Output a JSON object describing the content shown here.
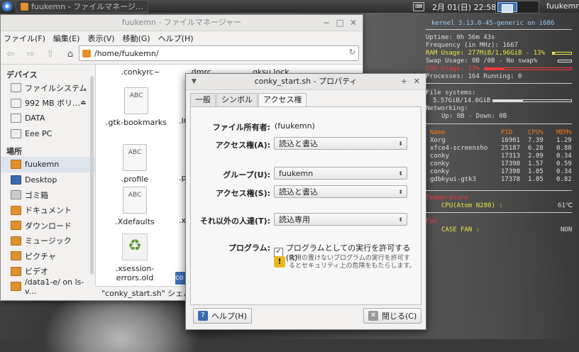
{
  "panel": {
    "task_title": "fuukemn - ファイルマネージ…",
    "clock": "2月 01(日) 22:58",
    "user": "fuukemn"
  },
  "fm": {
    "title": "fuukemn - ファイルマネージャー",
    "ctrl_min": "−",
    "ctrl_max": "□",
    "ctrl_close": "✕",
    "menus": [
      "ファイル(F)",
      "編集(E)",
      "表示(V)",
      "移動(G)",
      "ヘルプ(H)"
    ],
    "path": "/home/fuukemn/",
    "sidebar": {
      "devices_header": "デバイス",
      "places_header": "場所",
      "devices": [
        "ファイルシステム",
        "992 MB ボリ…",
        "DATA",
        "Eee PC"
      ],
      "places": [
        "fuukemn",
        "Desktop",
        "ゴミ箱",
        "ドキュメント",
        "ダウンロード",
        "ミュージック",
        "ピクチャ",
        "ビデオ",
        "/data1-e/ on ls-v..."
      ]
    },
    "files": {
      "conkyrc": ".conkyrc~",
      "dmrc": ".dmrc",
      "gksu": ".gksu.lock",
      "gtk": ".gtk-bookmarks",
      "profile": ".profile",
      "xdefaults": ".Xdefaults",
      "xsession": ".xsession-errors.old",
      "partial_ic": ".IC",
      "partial_p": ".p",
      "partial_xs1": ".xs",
      "partial_xs2": ".xs",
      "sel_chip": "co",
      "doc_label": "ABC",
      "recycle": "♻"
    },
    "status": "\"conky_start.sh\" シェルスク"
  },
  "dialog": {
    "title": "conky_start.sh - プロパティ",
    "tabs": [
      "一般",
      "シンボル",
      "アクセス権"
    ],
    "owner_label": "ファイル所有者:",
    "owner_value": "(fuukemn)",
    "access1_label": "アクセス権(A):",
    "access1_value": "読込と書込",
    "group_label": "グループ(U):",
    "group_value": "fuukemn",
    "access2_label": "アクセス権(S):",
    "access2_value": "読込と書込",
    "others_label": "それ以外の人達(T):",
    "others_value": "読込専用",
    "program_label": "プログラム:",
    "program_check": "プログラムとしての実行を許可する(R)",
    "warning": "信用の置けないプログラムの実行を許可するとセキュリティ上の危険をもたらします。",
    "help_btn": "ヘルプ(H)",
    "close_btn": "閉じる(C)"
  },
  "conky": {
    "kernel": "kernel 3.13.0-45-generic on i686",
    "uptime": "Uptime: 0h 56m 43s",
    "freq": "Frequency (in MHz): 1667",
    "ram": "RAM Usage: 277MiB/1,96GiB - 13%",
    "swap": "Swap Usage: 0B  /0B  - No swap%",
    "cpu": "CPU Usage: 23%",
    "procs": "Processes: 164  Running: 0",
    "fs_label": "File systems:",
    "fs": "5.57GiB/14.6GiB",
    "net_label": "Networking:",
    "net": "Up: 0B    - Down: 0B",
    "table_header": [
      "Name",
      "PID",
      "CPU%",
      "MEM%"
    ],
    "rows": [
      [
        "Xorg",
        "16901",
        "7.39",
        "1.29"
      ],
      [
        "xfce4-screensho",
        "25187",
        "6.28",
        "0.88"
      ],
      [
        "conky",
        "17313",
        "2.09",
        "0.34"
      ],
      [
        "conky",
        "17398",
        "1.57",
        "0.59"
      ],
      [
        "conky",
        "17398",
        "1.05",
        "0.34"
      ],
      [
        "gdbkyui-gtk3",
        "17378",
        "1.05",
        "0.82"
      ]
    ],
    "temp_label": "Temperature",
    "temp": "CPU(Atom N280) :",
    "temp_val": "61℃",
    "fan_label": "Fan",
    "fan": "CASE FAN  :",
    "fan_val": "NON",
    "ram_pct": 0.13,
    "swap_pct": 0,
    "cpu_pct": 0.23,
    "fs_pct": 0.38
  }
}
